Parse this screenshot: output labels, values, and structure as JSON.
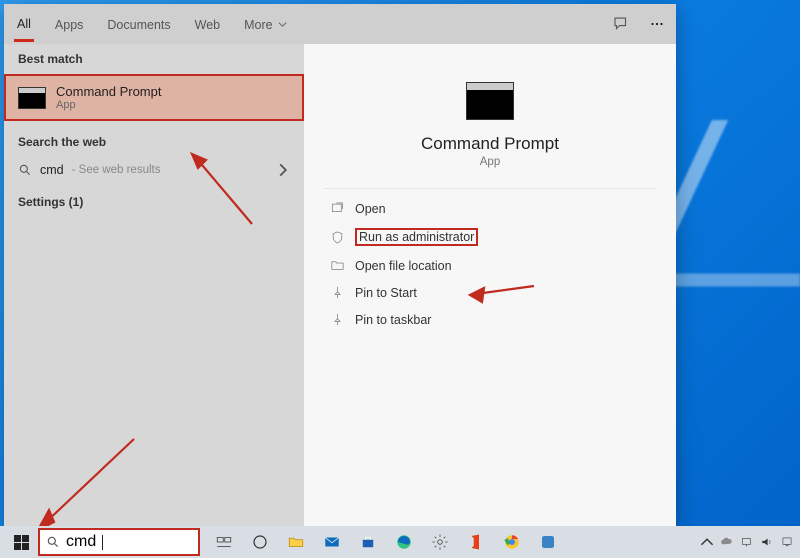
{
  "tabs": {
    "all": "All",
    "apps": "Apps",
    "documents": "Documents",
    "web": "Web",
    "more": "More"
  },
  "left_panel": {
    "best_match_header": "Best match",
    "best_match": {
      "title": "Command Prompt",
      "subtitle": "App"
    },
    "search_web_header": "Search the web",
    "web_query": "cmd",
    "web_suffix": " - See web results",
    "settings_header": "Settings (1)"
  },
  "right_panel": {
    "app_title": "Command Prompt",
    "app_subtitle": "App",
    "actions": {
      "open": "Open",
      "run_admin": "Run as administrator",
      "open_location": "Open file location",
      "pin_start": "Pin to Start",
      "pin_taskbar": "Pin to taskbar"
    }
  },
  "taskbar": {
    "search_value": "cmd"
  },
  "colors": {
    "highlight": "#c02a1f"
  }
}
